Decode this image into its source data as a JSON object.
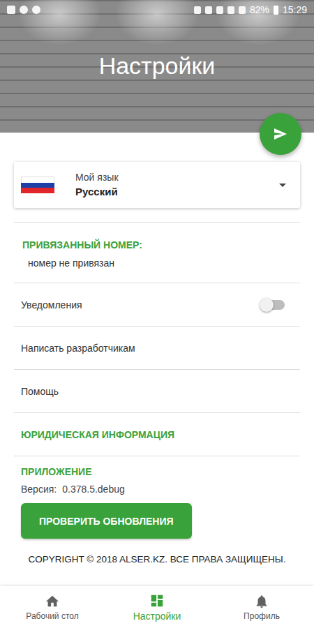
{
  "status_bar": {
    "battery": "82%",
    "time": "15:29"
  },
  "header": {
    "title": "Настройки"
  },
  "language": {
    "label": "Мой язык",
    "value": "Русский"
  },
  "linked_number": {
    "title": "ПРИВЯЗАННЫЙ НОМЕР:",
    "value": "номер не привязан"
  },
  "settings": [
    {
      "label": "Уведомления",
      "kind": "toggle",
      "on": false
    },
    {
      "label": "Написать разработчикам",
      "kind": "link",
      "on": false
    },
    {
      "label": "Помощь",
      "kind": "link",
      "on": false
    }
  ],
  "legal": {
    "title": "ЮРИДИЧЕСКАЯ ИНФОРМАЦИЯ"
  },
  "app": {
    "title": "ПРИЛОЖЕНИЕ",
    "version_label": "Версия:",
    "version": "0.378.5.debug",
    "button": "ПРОВЕРИТЬ ОБНОВЛЕНИЯ"
  },
  "copyright": "COPYRIGHT © 2018 ALSER.KZ. ВСЕ ПРАВА ЗАЩИЩЕНЫ.",
  "bottom_nav": [
    {
      "label": "Рабочий стол",
      "selected": false
    },
    {
      "label": "Настройки",
      "selected": true
    },
    {
      "label": "Профиль",
      "selected": false
    }
  ]
}
